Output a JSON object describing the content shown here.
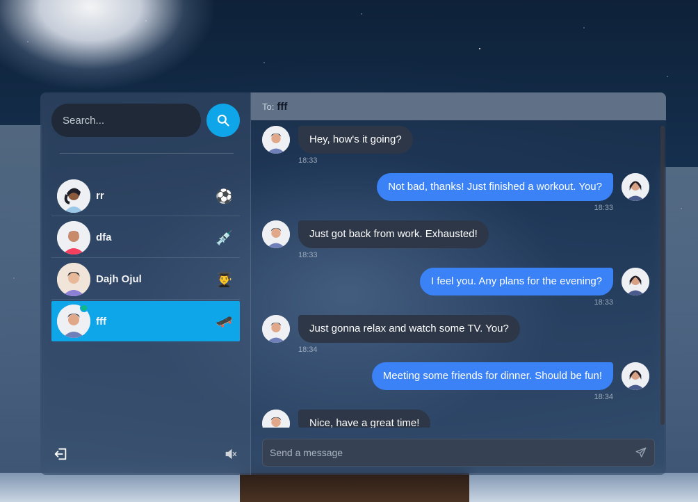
{
  "search": {
    "placeholder": "Search..."
  },
  "contacts": [
    {
      "name": "rr",
      "emoji": "⚽"
    },
    {
      "name": "dfa",
      "emoji": "💉"
    },
    {
      "name": "Dajh Ojul",
      "emoji": "👨‍🎓"
    },
    {
      "name": "fff",
      "emoji": "🛹"
    }
  ],
  "chat": {
    "to_label": "To:",
    "to_name": "fff",
    "messages": [
      {
        "text": "Hey, how's it going?",
        "time": "18:33"
      },
      {
        "text": "Not bad, thanks! Just finished a workout. You?",
        "time": "18:33"
      },
      {
        "text": "Just got back from work. Exhausted!",
        "time": "18:33"
      },
      {
        "text": "I feel you. Any plans for the evening?",
        "time": "18:33"
      },
      {
        "text": "Just gonna relax and watch some TV. You?",
        "time": "18:34"
      },
      {
        "text": "Meeting some friends for dinner. Should be fun!",
        "time": "18:34"
      },
      {
        "text": "Nice, have a great time!",
        "time": ""
      }
    ],
    "composer_placeholder": "Send a message"
  },
  "colors": {
    "accent": "#0ea5e9",
    "outgoing": "#3b82f6",
    "incoming": "#2d3748",
    "online": "#10b981"
  }
}
